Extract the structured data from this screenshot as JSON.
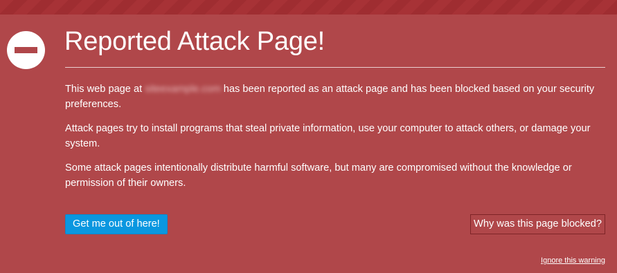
{
  "warning": {
    "title": "Reported Attack Page!",
    "paragraph1_before": "This web page at ",
    "blocked_url": "siteexample.com",
    "paragraph1_after": " has been reported as an attack page and has been blocked based on your security preferences.",
    "paragraph2": "Attack pages try to install programs that steal private information, use your computer to attack others, or damage your system.",
    "paragraph3": "Some attack pages intentionally distribute harmful software, but many are compromised without the knowledge or permission of their owners."
  },
  "actions": {
    "get_out_label": "Get me out of here!",
    "why_blocked_label": "Why was this page blocked?",
    "ignore_label": "Ignore this warning"
  },
  "icons": {
    "status_icon": "blocked-icon"
  },
  "colors": {
    "background": "#b0474a",
    "stripe": "#a73236",
    "primary_button": "#0a97e0"
  }
}
